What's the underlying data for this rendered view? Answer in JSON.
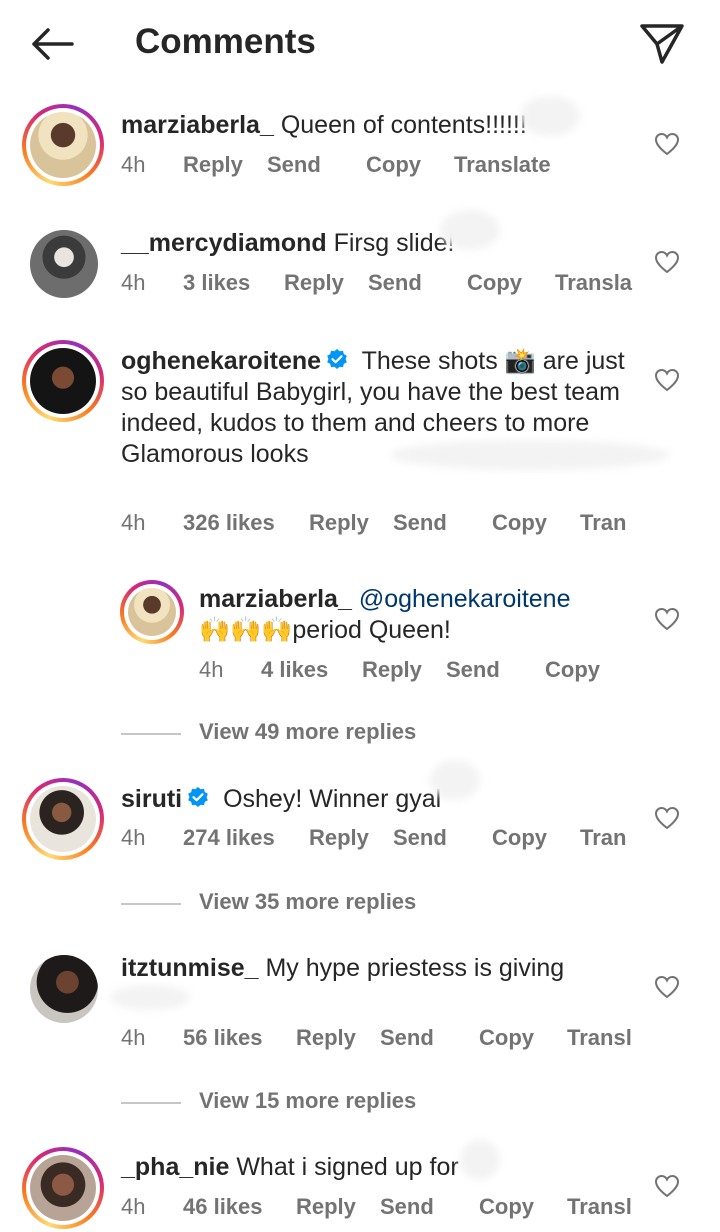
{
  "header": {
    "title": "Comments"
  },
  "comments": [
    {
      "username": "marziaberla_",
      "text": "Queen of contents!!!!!!",
      "time": "4h",
      "likes": "",
      "reply": "Reply",
      "send": "Send",
      "copy": "Copy",
      "translate": "Translate"
    },
    {
      "username": "__mercydiamond",
      "text": "Firsg slide!",
      "time": "4h",
      "likes": "3 likes",
      "reply": "Reply",
      "send": "Send",
      "copy": "Copy",
      "translate": "Transla"
    },
    {
      "username": "oghenekaroitene",
      "text": "These shots 📸 are just so beautiful Babygirl, you have the best team indeed, kudos to them and cheers to more Glamorous looks",
      "time": "4h",
      "likes": "326 likes",
      "reply": "Reply",
      "send": "Send",
      "copy": "Copy",
      "translate": "Tran"
    },
    {
      "username": "marziaberla_",
      "mention": "@oghenekaroitene",
      "text": "🙌🙌🙌period Queen!",
      "time": "4h",
      "likes": "4 likes",
      "reply": "Reply",
      "send": "Send",
      "copy": "Copy"
    },
    {
      "username": "siruti",
      "text": "Oshey! Winner gyal",
      "time": "4h",
      "likes": "274 likes",
      "reply": "Reply",
      "send": "Send",
      "copy": "Copy",
      "translate": "Tran"
    },
    {
      "username": "itztunmise_",
      "text": "My hype priestess is giving",
      "time": "4h",
      "likes": "56 likes",
      "reply": "Reply",
      "send": "Send",
      "copy": "Copy",
      "translate": "Transl"
    },
    {
      "username": "_pha_nie",
      "text": "What i signed up for",
      "time": "4h",
      "likes": "46 likes",
      "reply": "Reply",
      "send": "Send",
      "copy": "Copy",
      "translate": "Transl"
    }
  ],
  "view_more": [
    "View 49 more replies",
    "View 35 more replies",
    "View 15 more replies"
  ],
  "colors": {
    "text": "#262626",
    "secondary": "#737373",
    "verified": "#0095f6",
    "mention": "#00376b"
  },
  "icons": [
    "back-arrow-icon",
    "direct-send-icon",
    "verified-badge-icon",
    "heart-icon"
  ]
}
